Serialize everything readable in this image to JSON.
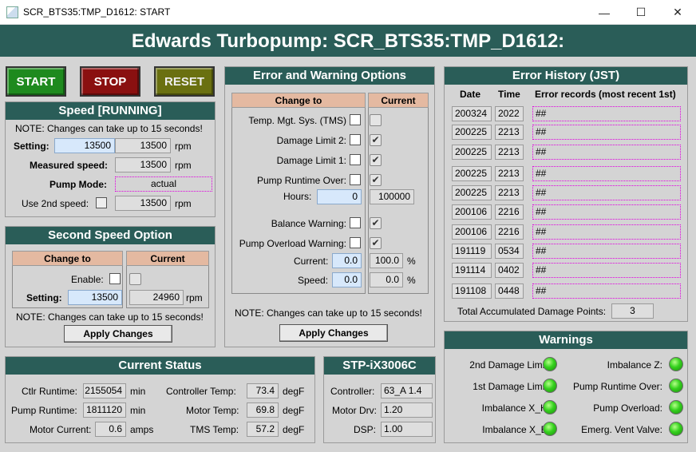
{
  "window": {
    "title": "SCR_BTS35:TMP_D1612: START"
  },
  "header": {
    "title": "Edwards Turbopump:  SCR_BTS35:TMP_D1612:"
  },
  "buttons": {
    "start": "START",
    "stop": "STOP",
    "reset": "RESET"
  },
  "colors": {
    "header_bg": "#2a5d58",
    "start": "#1e8a1e",
    "stop": "#8a1010",
    "reset": "#6a7010",
    "led": "#34d11d",
    "input_blue": "#d7e8fb",
    "peach": "#e4b9a1"
  },
  "speed": {
    "title": "Speed  [RUNNING]",
    "note": "NOTE:  Changes can take up to 15 seconds!",
    "setting_label": "Setting:",
    "setting_input": "13500",
    "setting_value": "13500",
    "unit": "rpm",
    "measured_label": "Measured speed:",
    "measured_value": "13500",
    "mode_label": "Pump Mode:",
    "mode_value": "actual",
    "second_label": "Use 2nd speed:",
    "second_value": "13500"
  },
  "second_speed": {
    "title": "Second Speed Option",
    "col_change": "Change to",
    "col_current": "Current",
    "enable_label": "Enable:",
    "setting_label": "Setting:",
    "setting_input": "13500",
    "setting_current": "24960",
    "unit": "rpm",
    "note": "NOTE:  Changes can take up to 15 seconds!",
    "apply": "Apply Changes"
  },
  "error_opts": {
    "title": "Error and Warning Options",
    "col_change": "Change to",
    "col_current": "Current",
    "rows": [
      {
        "label": "Temp. Mgt. Sys. (TMS)",
        "current": false
      },
      {
        "label": "Damage Limit 2:",
        "current": true
      },
      {
        "label": "Damage Limit 1:",
        "current": true
      },
      {
        "label": "Pump Runtime Over:",
        "current": true
      }
    ],
    "hours_label": "Hours:",
    "hours_input": "0",
    "hours_current": "100000",
    "rows2": [
      {
        "label": "Balance Warning:",
        "current": true
      },
      {
        "label": "Pump Overload Warning:",
        "current": true
      }
    ],
    "current_label": "Current:",
    "current_input": "0.0",
    "current_value": "100.0",
    "pct": "%",
    "speed_label": "Speed:",
    "speed_input": "0.0",
    "speed_value": "0.0",
    "note": "NOTE:  Changes can take up to 15 seconds!",
    "apply": "Apply Changes"
  },
  "history": {
    "title": "Error History (JST)",
    "col_date": "Date",
    "col_time": "Time",
    "col_records": "Error records (most recent 1st)",
    "rows": [
      {
        "date": "200324",
        "time": "2022",
        "rec": "##"
      },
      {
        "date": "200225",
        "time": "2213",
        "rec": "##"
      },
      {
        "date": "200225",
        "time": "2213",
        "rec": "##"
      },
      {
        "date": "200225",
        "time": "2213",
        "rec": "##"
      },
      {
        "date": "200225",
        "time": "2213",
        "rec": "##"
      },
      {
        "date": "200106",
        "time": "2216",
        "rec": "##"
      },
      {
        "date": "200106",
        "time": "2216",
        "rec": "##"
      },
      {
        "date": "191119",
        "time": "0534",
        "rec": "##"
      },
      {
        "date": "191114",
        "time": "0402",
        "rec": "##"
      },
      {
        "date": "191108",
        "time": "0448",
        "rec": "##"
      }
    ],
    "damage_label": "Total Accumulated Damage Points:",
    "damage_value": "3"
  },
  "warnings": {
    "title": "Warnings",
    "items": [
      {
        "label": "2nd Damage Limit:",
        "state": "ok"
      },
      {
        "label": "Imbalance Z:",
        "state": "ok"
      },
      {
        "label": "1st Damage Limit:",
        "state": "ok"
      },
      {
        "label": "Pump Runtime Over:",
        "state": "ok"
      },
      {
        "label": "Imbalance X_H:",
        "state": "ok"
      },
      {
        "label": "Pump Overload:",
        "state": "ok"
      },
      {
        "label": "Imbalance X_B:",
        "state": "ok"
      },
      {
        "label": "Emerg. Vent Valve:",
        "state": "ok"
      }
    ]
  },
  "status": {
    "title": "Current Status",
    "ctlr_runtime_label": "Ctlr Runtime:",
    "ctlr_runtime": "2155054",
    "pump_runtime_label": "Pump Runtime:",
    "pump_runtime": "1811120",
    "min": "min",
    "motor_current_label": "Motor Current:",
    "motor_current": "0.6",
    "amps": "amps",
    "ctrl_temp_label": "Controller Temp:",
    "ctrl_temp": "73.4",
    "motor_temp_label": "Motor Temp:",
    "motor_temp": "69.8",
    "tms_temp_label": "TMS Temp:",
    "tms_temp": "57.2",
    "degf": "degF"
  },
  "model": {
    "title": "STP-iX3006C",
    "controller_label": "Controller:",
    "controller": "63_A 1.4",
    "motor_label": "Motor Drv:",
    "motor": "1.20",
    "dsp_label": "DSP:",
    "dsp": "1.00"
  }
}
